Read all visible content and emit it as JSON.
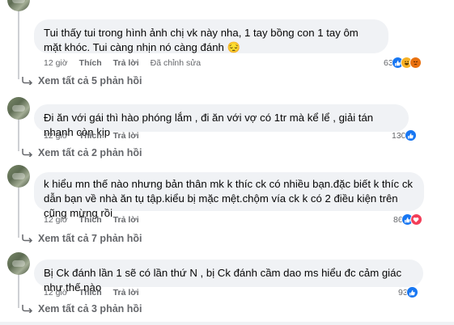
{
  "comments": [
    {
      "text": "Tui thấy tui trong hình ảnh chị vk này nha, 1 tay bồng con 1 tay ôm mặt khóc. Tui càng nhịn nó càng đánh 😔",
      "time": "12 giờ",
      "like_label": "Thích",
      "reply_label": "Trả lời",
      "edited_label": "Đã chỉnh sửa",
      "reaction_count": "63",
      "reaction_icons": [
        "like-icon",
        "haha-icon",
        "angry-icon"
      ],
      "view_replies": "Xem tất cả 5 phản hồi"
    },
    {
      "text": "Đi ăn với gái thì hào phóng lắm , đi ăn với vợ có 1tr mà kể lể , giải tán nhanh còn kịp",
      "time": "12 giờ",
      "like_label": "Thích",
      "reply_label": "Trả lời",
      "reaction_count": "130",
      "reaction_icons": [
        "like-icon"
      ],
      "view_replies": "Xem tất cả 2 phản hồi"
    },
    {
      "text": "k hiểu mn thế nào nhưng bản thân mk k thíc ck có nhiều bạn.đặc biết k thíc ck dẫn bạn về nhà ăn tụ tập.kiểu bị mặc mệt.chộm vía ck k có 2 điều kiện trên cũng mừng rồi",
      "time": "12 giờ",
      "like_label": "Thích",
      "reply_label": "Trả lời",
      "reaction_count": "86",
      "reaction_icons": [
        "like-icon",
        "love-icon"
      ],
      "view_replies": "Xem tất cả 7 phản hồi"
    },
    {
      "text": "Bị Ck đánh lần 1 sẽ có lần thứ N , bị Ck đánh cầm dao ms hiểu đc cảm giác như thế nào",
      "time": "12 giờ",
      "like_label": "Thích",
      "reply_label": "Trả lời",
      "reaction_count": "93",
      "reaction_icons": [
        "like-icon"
      ],
      "view_replies": "Xem tất cả 3 phản hồi"
    }
  ],
  "colors": {
    "bubble": "#f0f2f5",
    "meta": "#65676b",
    "like": "#1877f2",
    "love": "#f33e58",
    "haha": "#f7b125",
    "angry": "#e9710f"
  }
}
